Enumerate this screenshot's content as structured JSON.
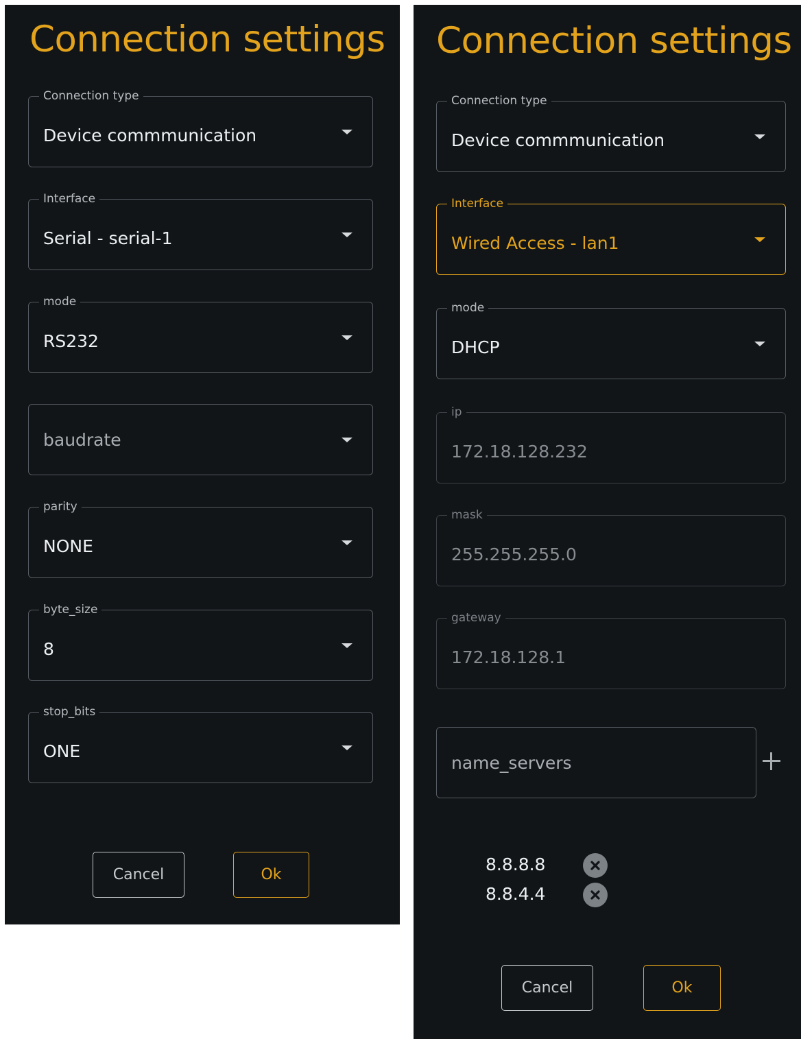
{
  "left_panel": {
    "title": "Connection settings",
    "fields": [
      {
        "label": "Connection type",
        "value": "Device commmunication"
      },
      {
        "label": "Interface",
        "value": "Serial - serial-1"
      },
      {
        "label": "mode",
        "value": "RS232"
      },
      {
        "label": "",
        "placeholder": "baudrate"
      },
      {
        "label": "parity",
        "value": "NONE"
      },
      {
        "label": "byte_size",
        "value": "8"
      },
      {
        "label": "stop_bits",
        "value": "ONE"
      }
    ],
    "cancel_label": "Cancel",
    "ok_label": "Ok"
  },
  "right_panel": {
    "title": "Connection settings",
    "fields": [
      {
        "label": "Connection type",
        "value": "Device commmunication"
      },
      {
        "label": "Interface",
        "value": "Wired Access - lan1",
        "focused": true
      },
      {
        "label": "mode",
        "value": "DHCP"
      },
      {
        "label": "ip",
        "value": "172.18.128.232",
        "disabled": true
      },
      {
        "label": "mask",
        "value": "255.255.255.0",
        "disabled": true
      },
      {
        "label": "gateway",
        "value": "172.18.128.1",
        "disabled": true
      }
    ],
    "name_servers_placeholder": "name_servers",
    "name_servers": [
      "8.8.8.8",
      "8.8.4.4"
    ],
    "cancel_label": "Cancel",
    "ok_label": "Ok"
  },
  "colors": {
    "background": "#111518",
    "accent": "#e3a31c",
    "text": "#eef0f2",
    "border": "#555b62"
  },
  "icons": {
    "dropdown": "chevron-down-icon",
    "add": "plus-icon",
    "remove": "remove-circle-icon"
  }
}
